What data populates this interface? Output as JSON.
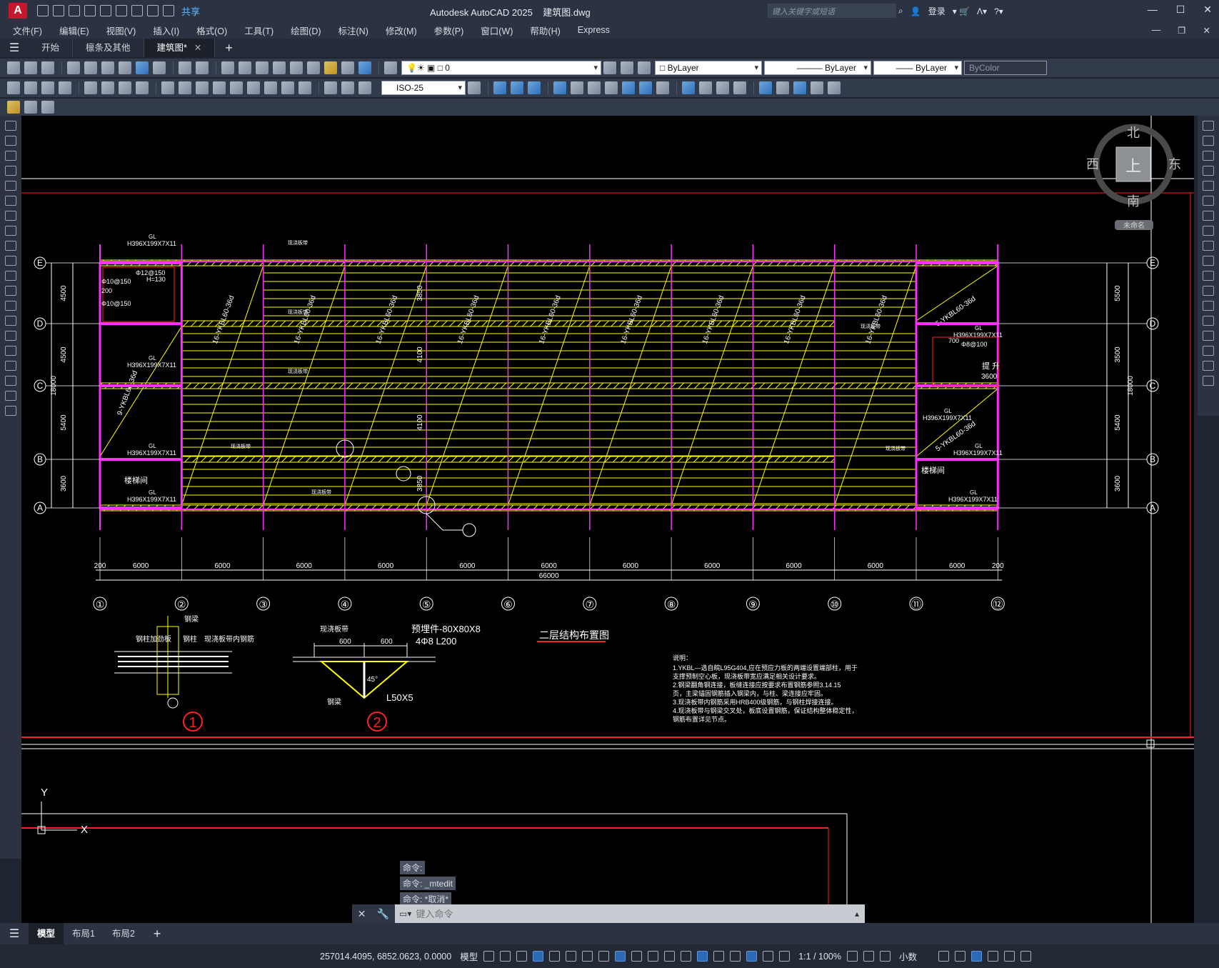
{
  "app": {
    "title": "Autodesk AutoCAD 2025",
    "filename": "建筑图.dwg",
    "search_placeholder": "键入关键字或短语",
    "login": "登录",
    "share": "共享",
    "logo": "A"
  },
  "menu": [
    "文件(F)",
    "编辑(E)",
    "视图(V)",
    "插入(I)",
    "格式(O)",
    "工具(T)",
    "绘图(D)",
    "标注(N)",
    "修改(M)",
    "参数(P)",
    "窗口(W)",
    "帮助(H)",
    "Express"
  ],
  "file_tabs": [
    {
      "label": "开始",
      "active": false
    },
    {
      "label": "檩条及其他",
      "active": false
    },
    {
      "label": "建筑图*",
      "active": true
    }
  ],
  "toolbar": {
    "layer": "0",
    "color": "ByLayer",
    "linetype": "ByLayer",
    "lineweight": "ByLayer",
    "plotstyle": "ByColor",
    "dimstyle": "ISO-25"
  },
  "viewcube": {
    "north": "北",
    "south": "南",
    "east": "东",
    "west": "西",
    "top": "上",
    "ucs": "未命名"
  },
  "drawing": {
    "title": "二层结构布置图",
    "grid_cols": [
      "①",
      "②",
      "③",
      "④",
      "⑤",
      "⑥",
      "⑦",
      "⑧",
      "⑨",
      "⑩",
      "⑪",
      "⑫"
    ],
    "grid_rows": [
      "E",
      "D",
      "C",
      "B",
      "A"
    ],
    "bay_dims": [
      "6000",
      "6000",
      "6000",
      "6000",
      "6000",
      "6000",
      "6000",
      "6000",
      "6000",
      "6000",
      "6000"
    ],
    "total_dim": "66000",
    "end_dim": "200",
    "left_dims": [
      "4500",
      "4500",
      "5400",
      "3600"
    ],
    "left_total": "18000",
    "right_dims": [
      "5500",
      "3500",
      "5400",
      "3600"
    ],
    "right_total": "18000",
    "mid_dims": [
      "3850",
      "4100",
      "4100",
      "3850"
    ],
    "beam_label": "H396X199X7X11",
    "gl": "GL",
    "slab_label": "16-YKBL60-36d",
    "slab_label_b": "9-YKBL60-36d",
    "slab_label_c": "5-YKBL60-36d",
    "stair": "楼梯间",
    "elevator": "提 升",
    "elevator_dim": "3600",
    "cast_label": "现浇板带",
    "callouts": [
      "Φ10@150",
      "Φ12@150",
      "Φ10@150",
      "H=130",
      "200",
      "700",
      "Φ8@100"
    ],
    "detail1": {
      "labels": [
        "钢梁",
        "钢柱加劲板",
        "钢柱",
        "现浇板带内钢筋"
      ],
      "tag": "1"
    },
    "detail2": {
      "labels": [
        "现浇板带",
        "预埋件-80X80X8",
        "4Φ8 L200",
        "600",
        "600",
        "钢梁",
        "45°",
        "L50X5"
      ],
      "tag": "2"
    },
    "notes_title": "说明：",
    "notes": [
      "1.YKBL—选自皖L95G404,应在预应力板的两端设置端部柱，用于",
      "  支撑预制空心板，现浇板带宽应满足相关设计要求。",
      "2.钢梁翻角钢连接，板缝连接应按要求布置钢筋参照3.14.15",
      "  页，主梁锚固钢筋插入钢梁内，与柱、梁连接应牢固。",
      "3.现浇板带内钢筋采用HRB400级钢筋，与钢柱焊接连接。",
      "4.现浇板带与钢梁交叉处，板底设置钢筋，保证结构整体稳定性，",
      "  钢筋布置详见节点。"
    ]
  },
  "command": {
    "history": [
      "命令:",
      "命令: _mtedit",
      "命令: *取消*"
    ],
    "placeholder": "键入命令"
  },
  "layouts": [
    {
      "label": "模型",
      "active": true
    },
    {
      "label": "布局1",
      "active": false
    },
    {
      "label": "布局2",
      "active": false
    }
  ],
  "status": {
    "coords": "257014.4095, 6852.0623, 0.0000",
    "model": "模型",
    "scale": "1:1 / 100%",
    "units": "小数"
  },
  "colors": {
    "beam": "#ff2fff",
    "slab": "#ffff00",
    "dim": "#ffffff",
    "frame": "#ff2020"
  }
}
